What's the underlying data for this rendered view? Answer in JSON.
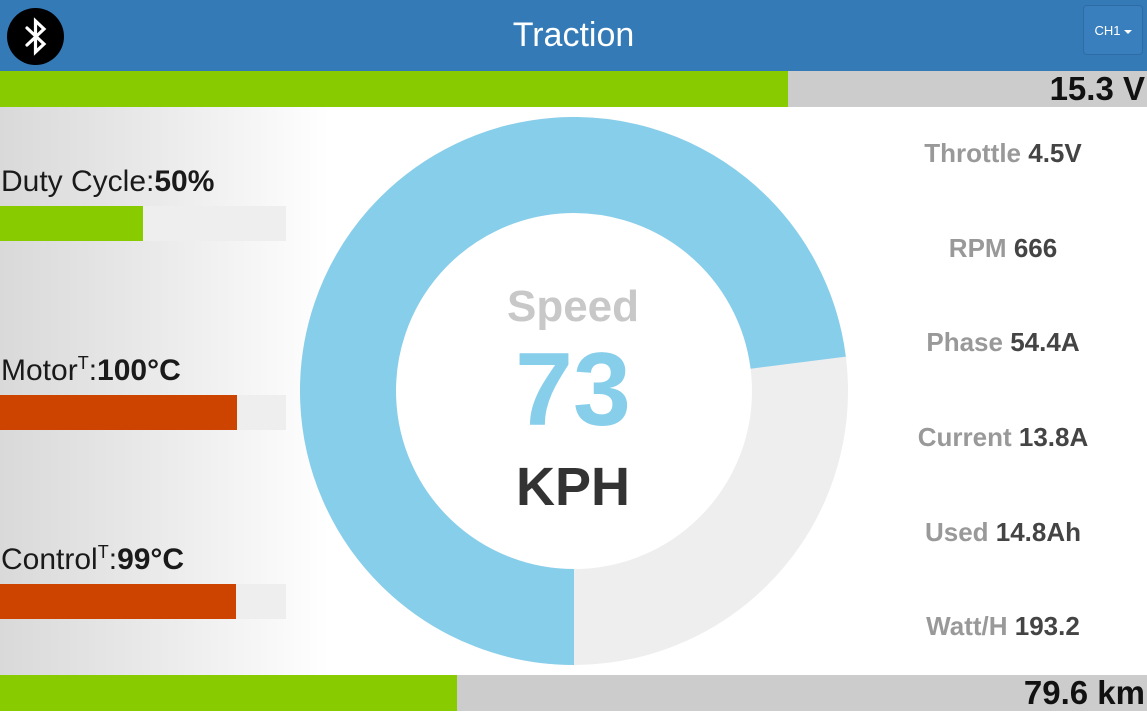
{
  "header": {
    "title": "Traction",
    "bluetooth_icon": "bluetooth-icon",
    "channel_button": "CH1"
  },
  "battery": {
    "text": "15.3 V",
    "fill_percent": 68.7,
    "color": "#88cc00"
  },
  "distance": {
    "text": "79.6 km",
    "fill_percent": 39.8,
    "color": "#88cc00"
  },
  "left_metrics": {
    "duty": {
      "label": "Duty Cycle:",
      "value": "50%",
      "fill_percent": 50,
      "color": "#88cc00"
    },
    "motor": {
      "label": "Motor",
      "sup": "T",
      "suffix": ":",
      "value": "100°C",
      "fill_percent": 83,
      "color": "#cc4400"
    },
    "control": {
      "label": "Control",
      "sup": "T",
      "suffix": ":",
      "value": "99°C",
      "fill_percent": 82.5,
      "color": "#cc4400"
    }
  },
  "gauge": {
    "label": "Speed",
    "value": "73",
    "unit": "KPH",
    "fill_fraction": 0.73,
    "fill_color": "#87ceeb",
    "track_color": "#eeeeee"
  },
  "stats": {
    "throttle": {
      "label": "Throttle",
      "value": "4.5V"
    },
    "rpm": {
      "label": "RPM",
      "value": "666"
    },
    "phase": {
      "label": "Phase",
      "value": "54.4A"
    },
    "current": {
      "label": "Current",
      "value": "13.8A"
    },
    "used": {
      "label": "Used",
      "value": "14.8Ah"
    },
    "watth": {
      "label": "Watt/H",
      "value": "193.2"
    }
  }
}
